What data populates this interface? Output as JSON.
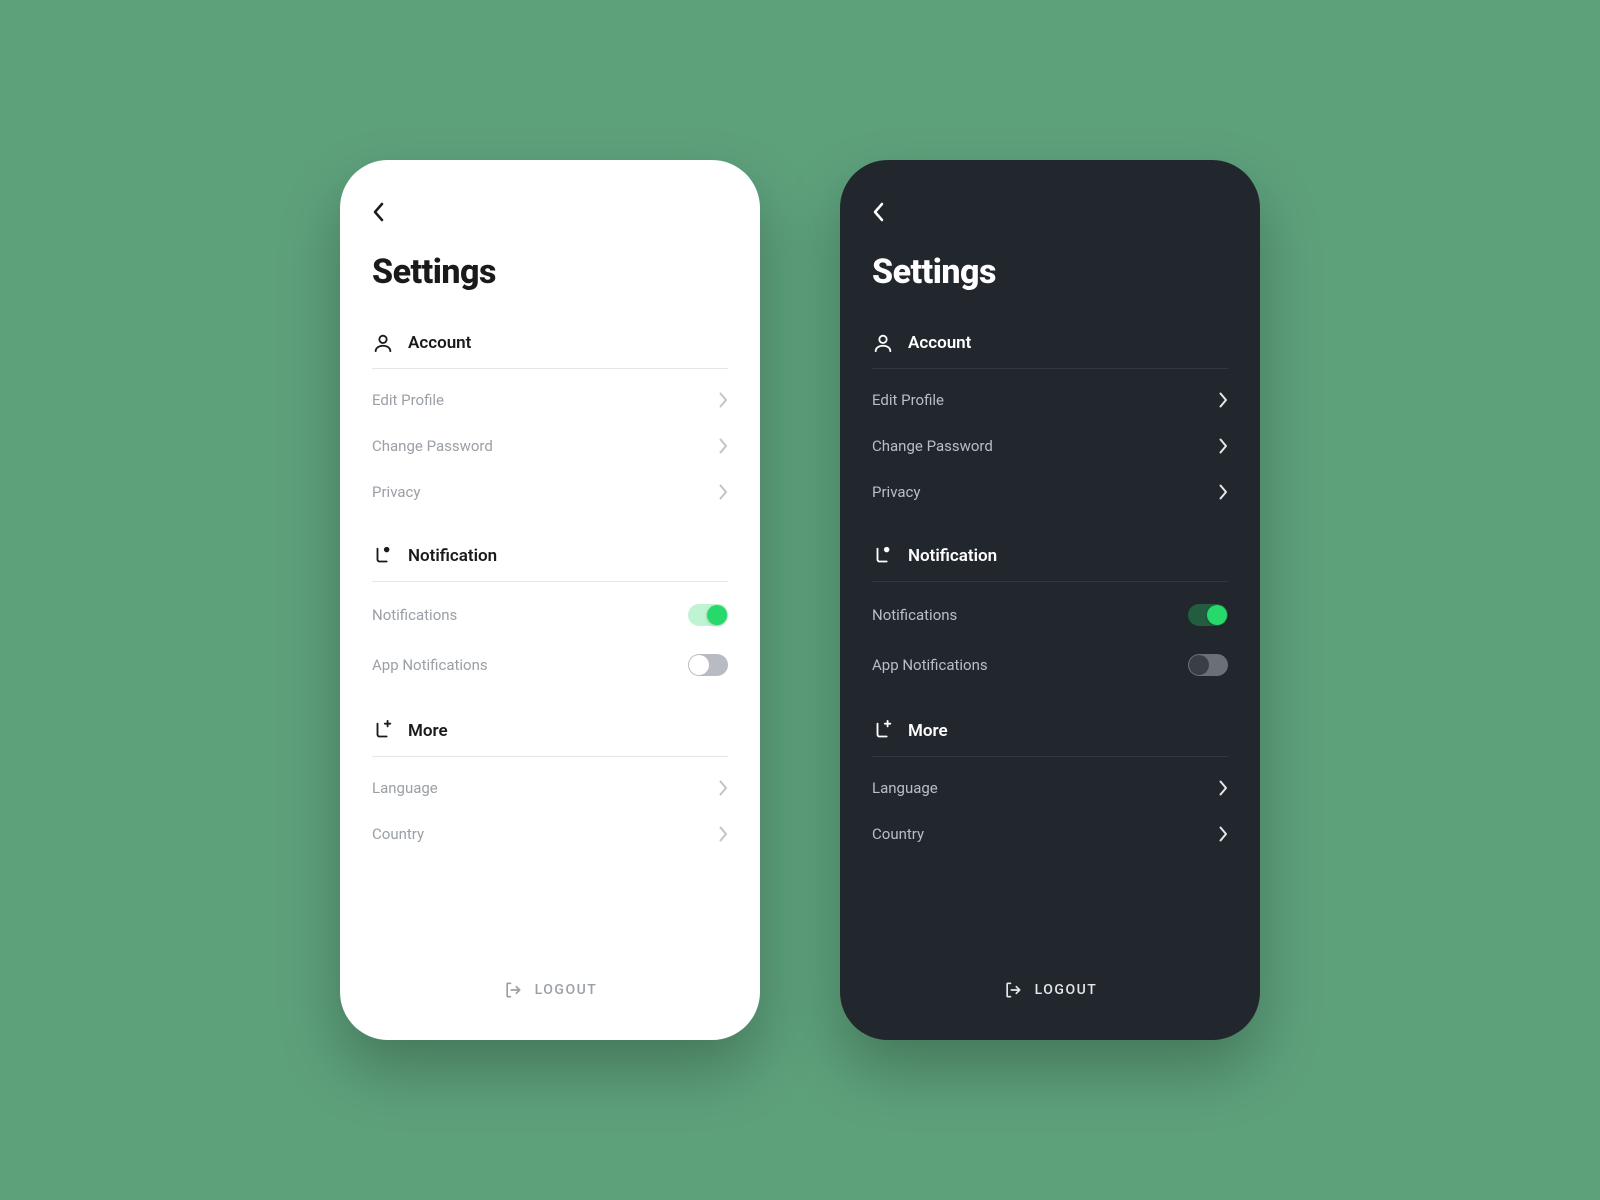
{
  "title": "Settings",
  "sections": {
    "account": {
      "label": "Account",
      "items": {
        "edit_profile": "Edit Profile",
        "change_password": "Change Password",
        "privacy": "Privacy"
      }
    },
    "notification": {
      "label": "Notification",
      "items": {
        "notifications": {
          "label": "Notifications",
          "on": true
        },
        "app_notifications": {
          "label": "App Notifications",
          "on": false
        }
      }
    },
    "more": {
      "label": "More",
      "items": {
        "language": "Language",
        "country": "Country"
      }
    }
  },
  "logout_label": "LOGOUT",
  "colors": {
    "background": "#5da17b",
    "light_bg": "#ffffff",
    "dark_bg": "#22272e",
    "accent": "#27d96b"
  }
}
